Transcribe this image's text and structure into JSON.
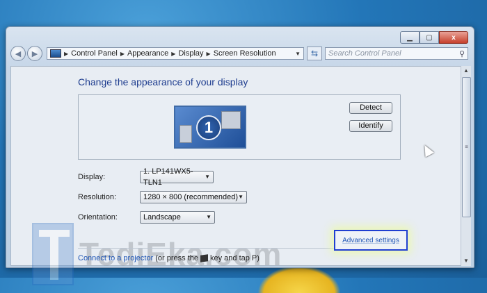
{
  "window": {
    "controls": [
      "minimize",
      "maximize",
      "close"
    ],
    "close_glyph": "x"
  },
  "address_bar": {
    "crumbs": [
      "Control Panel",
      "Appearance",
      "Display",
      "Screen Resolution"
    ]
  },
  "search": {
    "placeholder": "Search Control Panel"
  },
  "page": {
    "heading": "Change the appearance of your display",
    "monitor_number": "1",
    "detect_label": "Detect",
    "identify_label": "Identify",
    "display_label": "Display:",
    "display_value": "1. LP141WX5-TLN1",
    "resolution_label": "Resolution:",
    "resolution_value": "1280 × 800 (recommended)",
    "orientation_label": "Orientation:",
    "orientation_value": "Landscape",
    "advanced_settings": "Advanced settings",
    "projector_link": "Connect to a projector",
    "projector_text_a": "(or press the",
    "projector_text_b": "key and tap P)"
  },
  "watermark": {
    "text": "TediEka.com"
  },
  "colors": {
    "heading": "#1e3d8f",
    "link": "#1f55b5",
    "highlight_box": "#1f3ed1"
  }
}
